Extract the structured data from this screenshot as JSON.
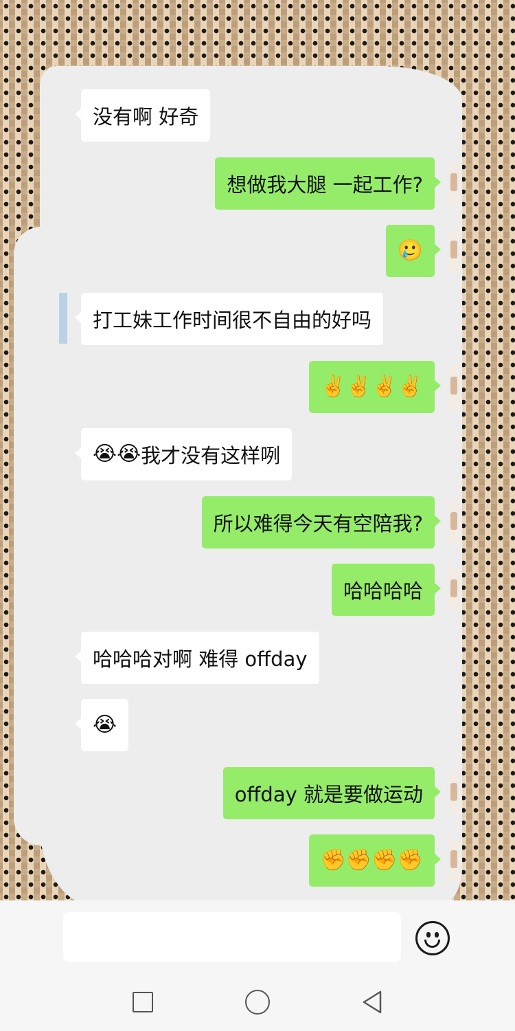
{
  "chat": {
    "messages": [
      {
        "side": "left",
        "text": "没有啊 好奇"
      },
      {
        "side": "right",
        "text": "想做我大腿 一起工作?"
      },
      {
        "side": "right",
        "emoji": [
          "🥲"
        ]
      },
      {
        "side": "left",
        "text": "打工妹工作时间很不自由的好吗"
      },
      {
        "side": "right",
        "emoji": [
          "✌️",
          "✌️",
          "✌️",
          "✌️"
        ]
      },
      {
        "side": "left",
        "emoji": [
          "😭",
          "😭"
        ],
        "text": "我才没有这样咧"
      },
      {
        "side": "right",
        "text": "所以难得今天有空陪我?"
      },
      {
        "side": "right",
        "text": "哈哈哈哈"
      },
      {
        "side": "left",
        "text": "哈哈哈对啊 难得 offday"
      },
      {
        "side": "left",
        "emoji": [
          "😭"
        ]
      },
      {
        "side": "right",
        "text": "offday 就是要做运动"
      },
      {
        "side": "right",
        "emoji": [
          "✊",
          "✊",
          "✊",
          "✊"
        ]
      }
    ]
  },
  "input": {
    "value": ""
  },
  "icons": {
    "emoji_button": "smiley-face-icon",
    "nav_recent": "square-icon",
    "nav_home": "circle-icon",
    "nav_back": "triangle-back-icon"
  },
  "colors": {
    "outgoing_bubble": "#95ec69",
    "incoming_bubble": "#ffffff",
    "chat_background": "#ededed"
  }
}
